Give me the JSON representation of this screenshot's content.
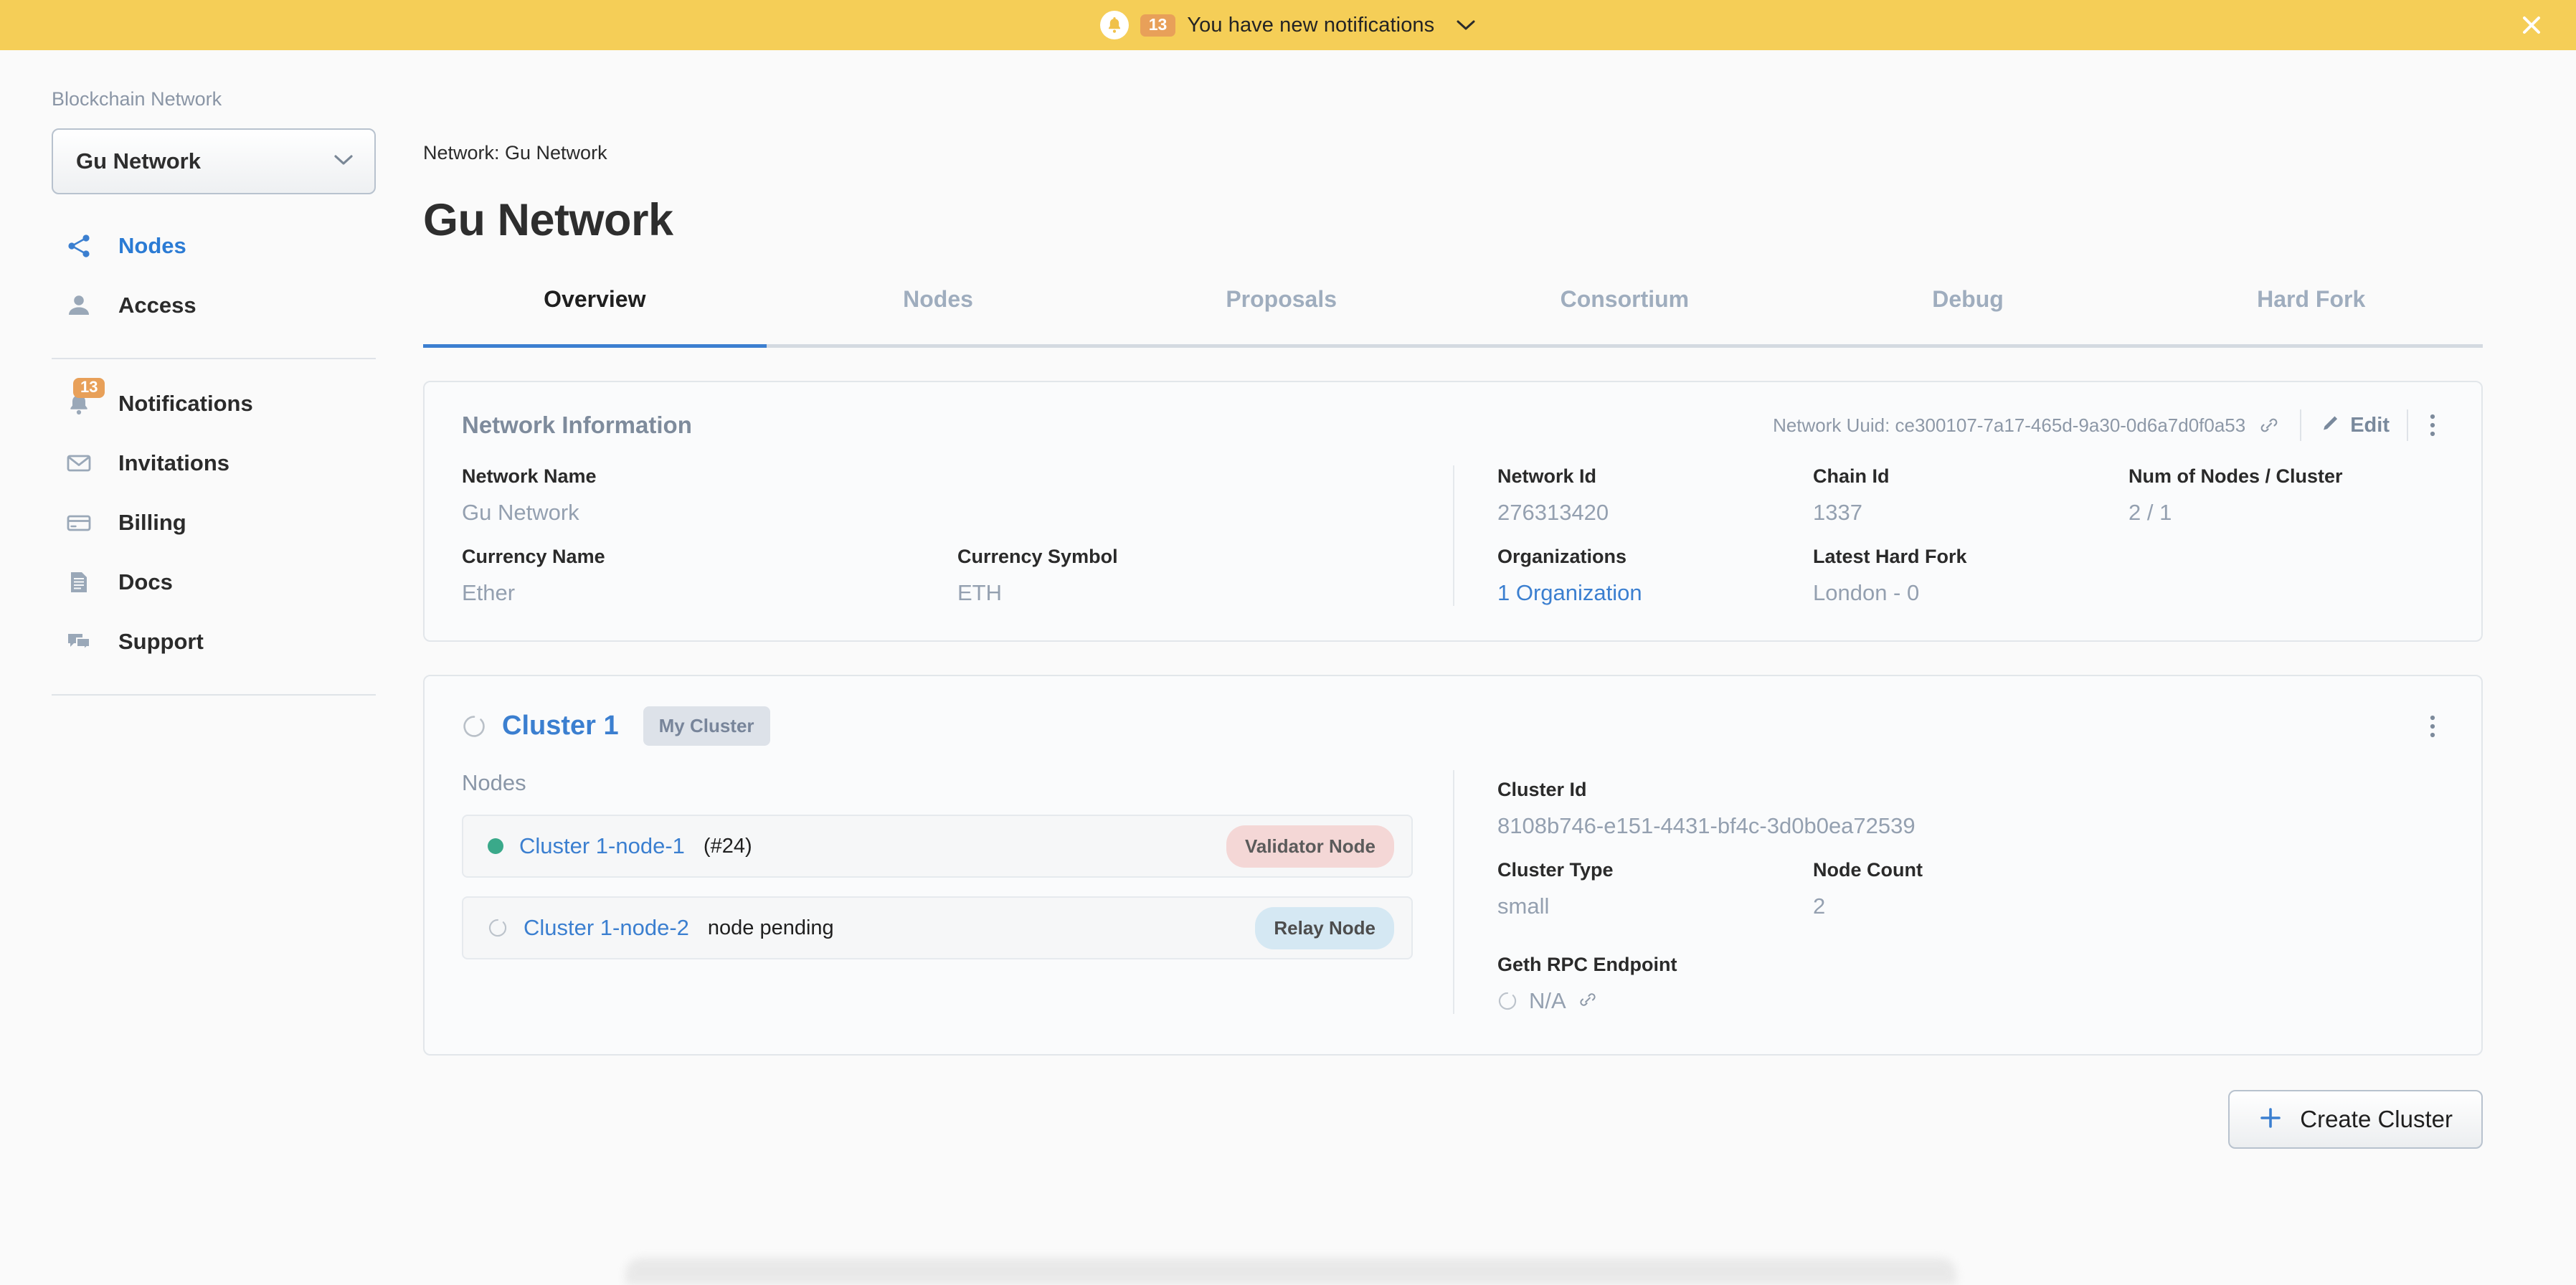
{
  "banner": {
    "bell_icon": "bell-icon",
    "count": "13",
    "message": "You have new notifications",
    "chevron_icon": "chevron-down-icon",
    "close_icon": "close-icon",
    "background": "#f5ce57",
    "badge_color": "#e8a059"
  },
  "sidebar": {
    "section_label": "Blockchain Network",
    "network_select": {
      "value": "Gu Network",
      "chevron_icon": "chevron-down-icon"
    },
    "primary_items": [
      {
        "label": "Nodes",
        "icon": "share-nodes-icon",
        "active": true
      },
      {
        "label": "Access",
        "icon": "person-icon",
        "active": false
      }
    ],
    "secondary_items": [
      {
        "label": "Notifications",
        "icon": "bell-icon",
        "badge": "13"
      },
      {
        "label": "Invitations",
        "icon": "envelope-icon",
        "badge": ""
      },
      {
        "label": "Billing",
        "icon": "credit-card-icon",
        "badge": ""
      },
      {
        "label": "Docs",
        "icon": "document-icon",
        "badge": ""
      },
      {
        "label": "Support",
        "icon": "chat-bubbles-icon",
        "badge": ""
      }
    ]
  },
  "main": {
    "breadcrumb": "Network: Gu Network",
    "title": "Gu Network",
    "tabs": [
      {
        "label": "Overview",
        "active": true
      },
      {
        "label": "Nodes",
        "active": false
      },
      {
        "label": "Proposals",
        "active": false
      },
      {
        "label": "Consortium",
        "active": false
      },
      {
        "label": "Debug",
        "active": false
      },
      {
        "label": "Hard Fork",
        "active": false
      }
    ],
    "accent_color": "#3c7fd0"
  },
  "network_information": {
    "title": "Network Information",
    "uuid_label": "Network Uuid: ce300107-7a17-465d-9a30-0d6a7d0f0a53",
    "copy_icon": "link-icon",
    "edit_label": "Edit",
    "edit_icon": "pencil-icon",
    "more_icon": "kebab-menu-icon",
    "left_fields": [
      [
        {
          "label": "Network Name",
          "value": "Gu Network",
          "link": false
        }
      ],
      [
        {
          "label": "Currency Name",
          "value": "Ether",
          "link": false
        },
        {
          "label": "Currency Symbol",
          "value": "ETH",
          "link": false
        }
      ]
    ],
    "right_fields": [
      [
        {
          "label": "Network Id",
          "value": "276313420",
          "link": false
        },
        {
          "label": "Chain Id",
          "value": "1337",
          "link": false
        },
        {
          "label": "Num of Nodes / Cluster",
          "value": "2 / 1",
          "link": false
        }
      ],
      [
        {
          "label": "Organizations",
          "value": "1 Organization",
          "link": true
        },
        {
          "label": "Latest Hard Fork",
          "value": "London - 0",
          "link": false
        },
        {
          "label": "",
          "value": "",
          "link": false
        }
      ]
    ]
  },
  "cluster": {
    "status_icon": "spinner-icon",
    "name": "Cluster 1",
    "chip": "My Cluster",
    "more_icon": "kebab-menu-icon",
    "nodes_label": "Nodes",
    "nodes": [
      {
        "status_icon": "status-dot-online",
        "name": "Cluster 1-node-1",
        "sub": "(#24)",
        "badge": "Validator Node",
        "badge_color": "#f4d7d6"
      },
      {
        "status_icon": "spinner-icon",
        "name": "Cluster 1-node-2",
        "sub": "node pending",
        "badge": "Relay Node",
        "badge_color": "#d5e8f3"
      }
    ],
    "details": {
      "cluster_id_label": "Cluster Id",
      "cluster_id_value": "8108b746-e151-4431-bf4c-3d0b0ea72539",
      "cluster_type_label": "Cluster Type",
      "cluster_type_value": "small",
      "node_count_label": "Node Count",
      "node_count_value": "2",
      "rpc_label": "Geth RPC Endpoint",
      "rpc_value": "N/A",
      "rpc_icon": "link-icon",
      "rpc_status_icon": "spinner-icon"
    }
  },
  "footer": {
    "create_cluster_label": "Create Cluster",
    "plus_icon": "plus-icon"
  }
}
